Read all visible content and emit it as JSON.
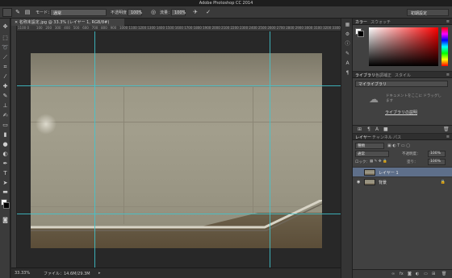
{
  "window": {
    "title": "Adobe Photoshop CC 2014"
  },
  "options_bar": {
    "mode_label": "モード：",
    "mode_value": "通常",
    "opacity_label": "不透明度：",
    "opacity_value": "100%",
    "flow_label": "流量：",
    "flow_value": "100%",
    "workspace": "初期設定"
  },
  "document": {
    "tab_title": "名称未設定.jpg @ 33.3% (レイヤー 1, RGB/8#)",
    "ruler_ticks": [
      "1100",
      "0",
      "100",
      "200",
      "300",
      "400",
      "500",
      "600",
      "700",
      "800",
      "900",
      "1000",
      "1100",
      "1200",
      "1300",
      "1400",
      "1500",
      "1600",
      "1700",
      "1800",
      "1900",
      "2000",
      "2100",
      "2200",
      "2300",
      "2400",
      "2500",
      "2600",
      "2700",
      "2800",
      "2900",
      "3000",
      "3100",
      "3200",
      "3300"
    ]
  },
  "status": {
    "zoom": "33.33%",
    "file_info": "ファイル：14.6M/29.3M"
  },
  "color_panel": {
    "tabs": [
      "カラー",
      "スウォッチ"
    ],
    "fg": "#ffffff",
    "bg": "#000000"
  },
  "library_panel": {
    "tabs": [
      "ライブラリ",
      "色調補正",
      "スタイル"
    ],
    "selected_library": "マイライブラリ",
    "message": "ドキュメントをここに ドラッグします",
    "link": "ライブラリの説明"
  },
  "layers_panel": {
    "tabs": [
      "レイヤー",
      "チャンネル",
      "パス"
    ],
    "filter_kind": "種類",
    "blend_mode": "通常",
    "opacity_label": "不透明度：",
    "opacity_value": "100%",
    "lock_label": "ロック：",
    "fill_label": "塗り：",
    "fill_value": "100%",
    "layers": [
      {
        "name": "レイヤー 1",
        "selected": true
      },
      {
        "name": "背景",
        "selected": false
      }
    ]
  },
  "colors": {
    "guide": "#3fc6cf",
    "selection": "#5e6f8a"
  }
}
